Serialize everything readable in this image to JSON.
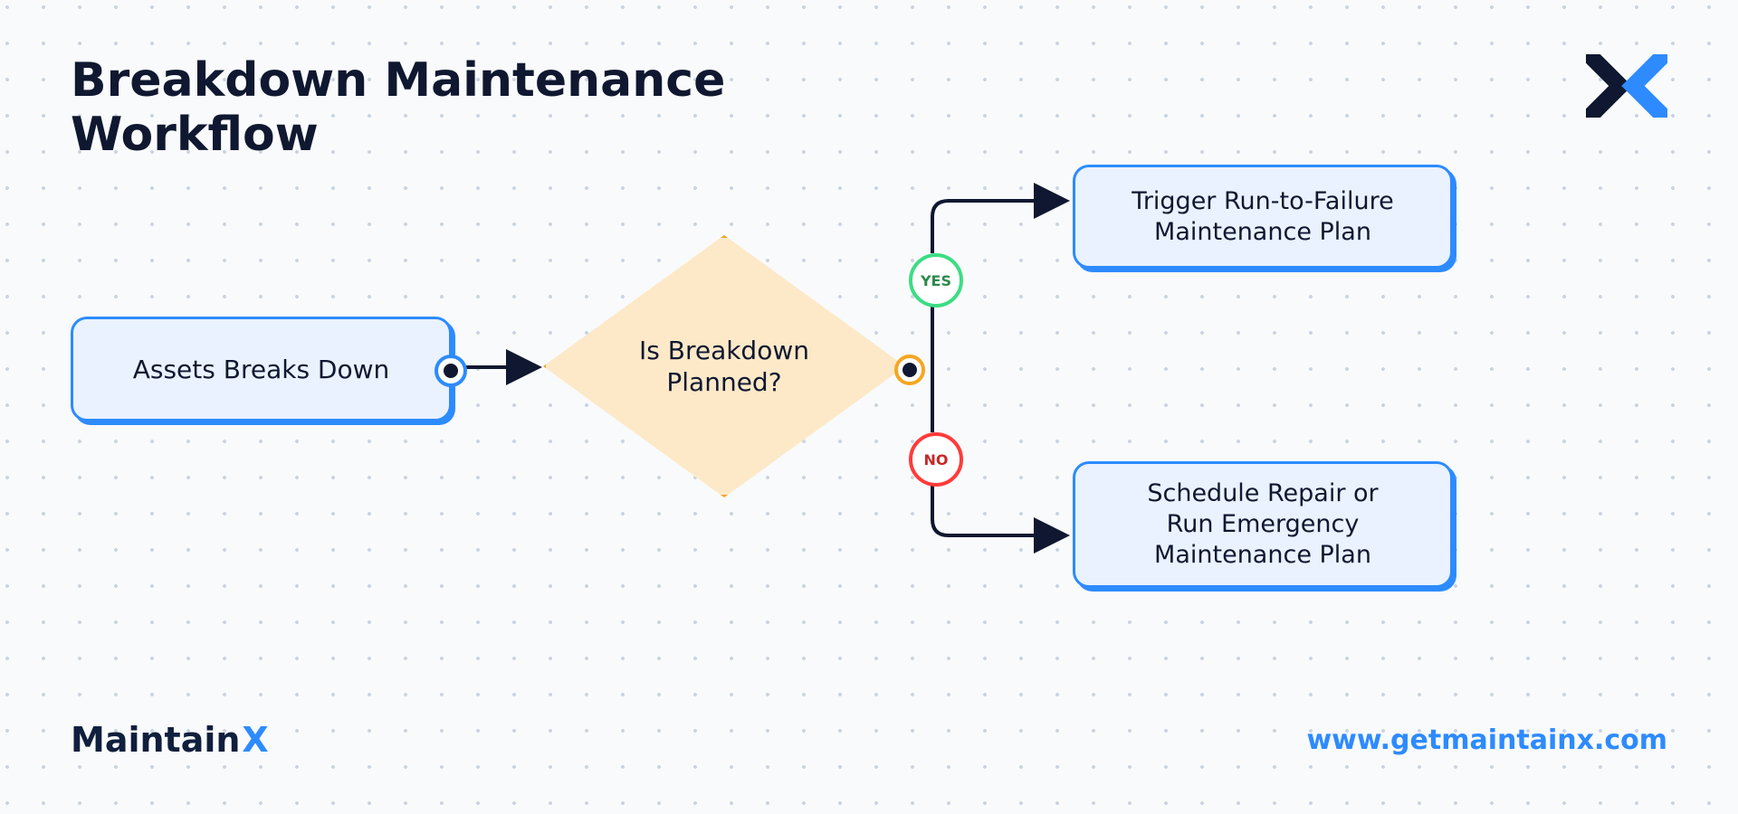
{
  "title": "Breakdown Maintenance\nWorkflow",
  "nodes": {
    "start": "Assets Breaks Down",
    "decision": "Is Breakdown\nPlanned?",
    "yes_badge": "YES",
    "no_badge": "NO",
    "outcome_yes": "Trigger Run-to-Failure\nMaintenance Plan",
    "outcome_no": "Schedule Repair or\nRun Emergency\nMaintenance Plan"
  },
  "footer": {
    "brand_main": "Maintain",
    "brand_accent": "X",
    "url": "www.getmaintainx.com"
  },
  "colors": {
    "blue": "#2d8bff",
    "orange": "#f5a623",
    "green": "#3ddc84",
    "red": "#ff3b3b",
    "navy": "#0f1830",
    "box_fill": "#eaf2ff",
    "diamond_fill": "#fde9c8"
  },
  "flow": [
    {
      "from": "start",
      "to": "decision",
      "type": "arrow"
    },
    {
      "from": "decision",
      "branch": "YES",
      "to": "outcome_yes"
    },
    {
      "from": "decision",
      "branch": "NO",
      "to": "outcome_no"
    }
  ]
}
